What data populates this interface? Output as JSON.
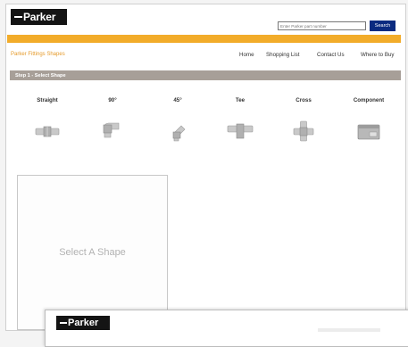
{
  "header": {
    "logo_text": "Parker",
    "search": {
      "placeholder": "Enter Parker part number",
      "button_label": "Search"
    }
  },
  "colors": {
    "accent_orange": "#f2ac2a",
    "search_blue": "#0b2b80",
    "step_bar": "#a79f98"
  },
  "subnav": {
    "brand_link": "Parker Fittings Shapes",
    "links": [
      "Home",
      "Shopping List",
      "Contact Us",
      "Where to Buy"
    ]
  },
  "step": {
    "title": "Step 1 - Select Shape"
  },
  "shapes": [
    {
      "label": "Straight",
      "icon": "straight-fitting-icon"
    },
    {
      "label": "90°",
      "icon": "elbow-90-fitting-icon"
    },
    {
      "label": "45°",
      "icon": "elbow-45-fitting-icon"
    },
    {
      "label": "Tee",
      "icon": "tee-fitting-icon"
    },
    {
      "label": "Cross",
      "icon": "cross-fitting-icon"
    },
    {
      "label": "Component",
      "icon": "component-box-icon"
    }
  ],
  "preview": {
    "text": "Select A Shape"
  },
  "overlay_window": {
    "logo_text": "Parker"
  }
}
